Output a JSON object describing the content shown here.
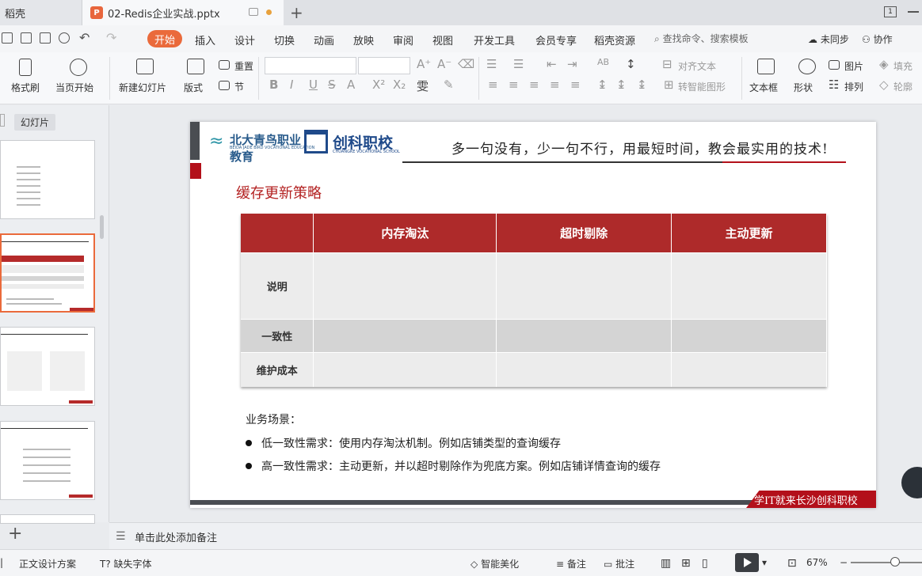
{
  "titlebar": {
    "home_tab": "稻壳",
    "doc_tab": "02-Redis企业实战.pptx",
    "new_tab": "+",
    "page_indicator": "1"
  },
  "menu": {
    "items": [
      "开始",
      "插入",
      "设计",
      "切换",
      "动画",
      "放映",
      "审阅",
      "视图",
      "开发工具",
      "会员专享",
      "稻壳资源"
    ],
    "search_placeholder": "查找命令、搜索模板",
    "sync": "未同步",
    "collab": "协作"
  },
  "ribbon": {
    "format_brush": "格式刷",
    "play_from_current": "当页开始",
    "new_slide": "新建幻灯片",
    "layout": "版式",
    "reset": "重置",
    "section": "节",
    "align_text": "对齐文本",
    "smart_shape": "转智能图形",
    "textbox": "文本框",
    "shape": "形状",
    "picture": "图片",
    "arrange": "排列",
    "fill": "填充",
    "outline": "轮廓"
  },
  "leftpane": {
    "tab_slides": "幻灯片"
  },
  "slide": {
    "logo1_cn": "北大青鸟职业教育",
    "logo1_en": "BEIDA JADE BIRD VOCATIONAL EDUCATION",
    "logo2_cn": "创科职校",
    "logo2_en": "CHUANGKE VOCATIONAL SCHOOL",
    "slogan": "多一句没有，少一句不行，用最短时间，教会最实用的技术!",
    "title": "缓存更新策略",
    "table": {
      "headers": [
        "",
        "内存淘汰",
        "超时剔除",
        "主动更新"
      ],
      "rows": [
        {
          "label": "说明",
          "cells": [
            "",
            "",
            ""
          ]
        },
        {
          "label": "一致性",
          "cells": [
            "",
            "",
            ""
          ]
        },
        {
          "label": "维护成本",
          "cells": [
            "",
            "",
            ""
          ]
        }
      ]
    },
    "scenario_label": "业务场景：",
    "bullets": [
      "低一致性需求：使用内存淘汰机制。例如店铺类型的查询缓存",
      "高一致性需求：主动更新，并以超时剔除作为兜底方案。例如店铺详情查询的缓存"
    ],
    "footer": "学IT就来长沙创科职校"
  },
  "notes": {
    "placeholder": "单击此处添加备注"
  },
  "status": {
    "theme": "正文设计方案",
    "missing_font": "缺失字体",
    "beautify": "智能美化",
    "notes": "备注",
    "comments": "批注",
    "zoom": "67%"
  }
}
